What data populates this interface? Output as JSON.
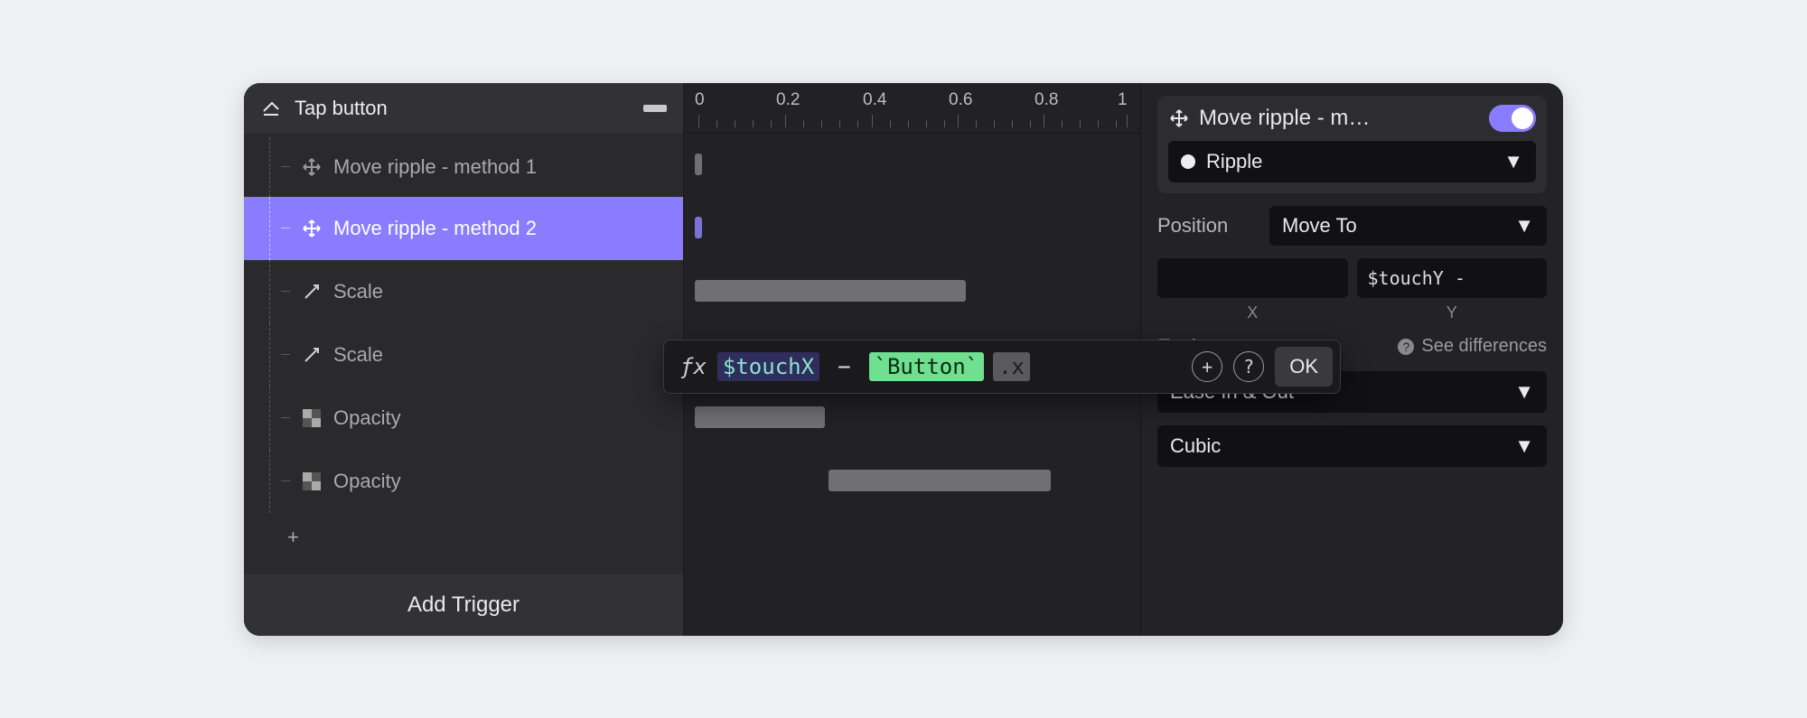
{
  "trigger": {
    "title": "Tap button"
  },
  "tree": {
    "items": [
      {
        "icon": "move-icon",
        "label": "Move ripple - method 1",
        "selected": false
      },
      {
        "icon": "move-icon",
        "label": "Move ripple - method 2",
        "selected": true
      },
      {
        "icon": "scale-icon",
        "label": "Scale",
        "selected": false
      },
      {
        "icon": "scale-icon",
        "label": "Scale",
        "selected": false
      },
      {
        "icon": "opacity-icon",
        "label": "Opacity",
        "selected": false
      },
      {
        "icon": "opacity-icon",
        "label": "Opacity",
        "selected": false
      }
    ],
    "add_trigger": "Add Trigger"
  },
  "ruler": {
    "ticks": [
      "0",
      "0.2",
      "0.4",
      "0.6",
      "0.8",
      "1"
    ]
  },
  "inspector": {
    "title": "Move ripple - m…",
    "target": "Ripple",
    "position": {
      "label": "Position",
      "mode": "Move To"
    },
    "y_value": "$touchY -",
    "axis_x": "X",
    "axis_y": "Y",
    "easing": {
      "label": "Easing",
      "hint": "See differences",
      "type": "Ease In & Out",
      "curve": "Cubic"
    }
  },
  "formula": {
    "var": "$touchX",
    "op": "−",
    "ref": "`Button`",
    "prop": ".x",
    "ok": "OK"
  }
}
